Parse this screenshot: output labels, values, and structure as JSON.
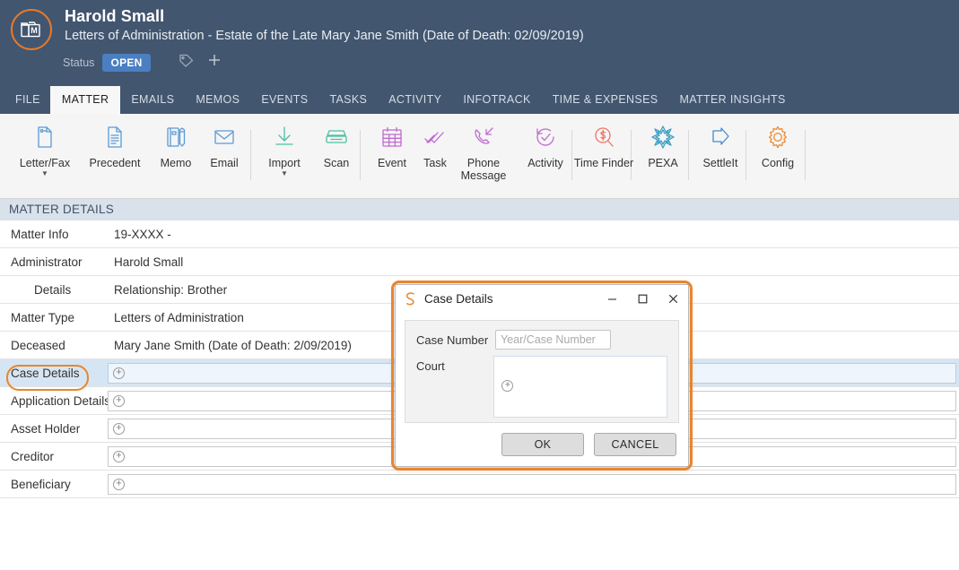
{
  "header": {
    "matter_icon": "folder-m-icon",
    "title": "Harold Small",
    "subtitle": "Letters of Administration - Estate of the Late Mary Jane Smith (Date of Death: 02/09/2019)",
    "status_label": "Status",
    "status_value": "OPEN",
    "tag_icon": "tag-icon",
    "add_tag_icon": "plus-icon",
    "bg_color": "#42566f",
    "accent_color": "#4a7fc1"
  },
  "tabs": [
    {
      "label": "FILE",
      "active": false
    },
    {
      "label": "MATTER",
      "active": true
    },
    {
      "label": "EMAILS",
      "active": false
    },
    {
      "label": "MEMOS",
      "active": false
    },
    {
      "label": "EVENTS",
      "active": false
    },
    {
      "label": "TASKS",
      "active": false
    },
    {
      "label": "ACTIVITY",
      "active": false
    },
    {
      "label": "INFOTRACK",
      "active": false
    },
    {
      "label": "TIME & EXPENSES",
      "active": false
    },
    {
      "label": "MATTER INSIGHTS",
      "active": false
    }
  ],
  "ribbon": [
    {
      "label": "Letter/Fax",
      "icon": "document-page-icon",
      "color": "#5b9bd5",
      "caret": true
    },
    {
      "label": "Precedent",
      "icon": "document-lines-icon",
      "color": "#5b9bd5",
      "caret": false
    },
    {
      "label": "Memo",
      "icon": "notebook-pencil-icon",
      "color": "#5b9bd5",
      "caret": false
    },
    {
      "label": "Email",
      "icon": "envelope-icon",
      "color": "#5b9bd5",
      "caret": false
    },
    {
      "label": "Import",
      "icon": "download-arrow-icon",
      "color": "#4cc0a0",
      "caret": true
    },
    {
      "label": "Scan",
      "icon": "scanner-icon",
      "color": "#4cc0a0",
      "caret": false
    },
    {
      "label": "Event",
      "icon": "calendar-icon",
      "color": "#c06ad0",
      "caret": false
    },
    {
      "label": "Task",
      "icon": "checklist-icon",
      "color": "#c06ad0",
      "caret": false
    },
    {
      "label": "Phone Message",
      "icon": "phone-incoming-icon",
      "color": "#c06ad0",
      "caret": false
    },
    {
      "label": "Activity",
      "icon": "clock-check-icon",
      "color": "#c06ad0",
      "caret": false
    },
    {
      "label": "Time Finder",
      "icon": "dollar-search-icon",
      "color": "#ef7264",
      "caret": false
    },
    {
      "label": "PEXA",
      "icon": "pexa-star-icon",
      "color": "#3f9fc4",
      "caret": false
    },
    {
      "label": "SettleIt",
      "icon": "arrow-right-outline-icon",
      "color": "#3f8fd0",
      "caret": false
    },
    {
      "label": "Config",
      "icon": "gear-icon",
      "color": "#ef8a33",
      "caret": false
    }
  ],
  "section": {
    "title": "MATTER DETAILS"
  },
  "detail_rows": [
    {
      "label": "Matter Info",
      "value": "19-XXXX -",
      "type": "text",
      "indent": false,
      "selected": false
    },
    {
      "label": "Administrator",
      "value": "Harold Small",
      "type": "text",
      "indent": false,
      "selected": false
    },
    {
      "label": "Details",
      "value": "Relationship: Brother",
      "type": "text",
      "indent": true,
      "selected": false
    },
    {
      "label": "Matter Type",
      "value": "Letters of Administration",
      "type": "text",
      "indent": false,
      "selected": false
    },
    {
      "label": "Deceased",
      "value": "Mary Jane Smith (Date of Death: 2/09/2019)",
      "type": "text",
      "indent": false,
      "selected": false
    },
    {
      "label": "Case Details",
      "value": "",
      "type": "input",
      "indent": false,
      "selected": true
    },
    {
      "label": "Application Details",
      "value": "",
      "type": "input",
      "indent": false,
      "selected": false
    },
    {
      "label": "Asset Holder",
      "value": "",
      "type": "input",
      "indent": false,
      "selected": false
    },
    {
      "label": "Creditor",
      "value": "",
      "type": "input",
      "indent": false,
      "selected": false
    },
    {
      "label": "Beneficiary",
      "value": "",
      "type": "input",
      "indent": false,
      "selected": false
    }
  ],
  "annotations": {
    "highlight_color": "#e8862c",
    "label_ring_target": "Case Details",
    "dialog_ring_target": "Case Details dialog"
  },
  "dialog": {
    "app_icon": "smokeball-swirl-icon",
    "title": "Case Details",
    "minimize_icon": "minimize-icon",
    "maximize_icon": "maximize-icon",
    "close_icon": "close-icon",
    "fields": [
      {
        "label": "Case Number",
        "value": "",
        "placeholder": "Year/Case Number",
        "type": "input"
      },
      {
        "label": "Court",
        "value": "",
        "placeholder": "",
        "type": "box"
      }
    ],
    "ok_label": "OK",
    "cancel_label": "CANCEL"
  }
}
